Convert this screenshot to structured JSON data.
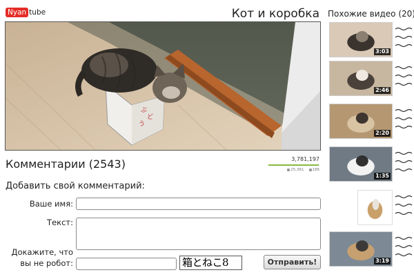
{
  "header": {
    "logo_red": "Nyan",
    "logo_rest": "tube",
    "title": "Кот и коробка"
  },
  "video": {
    "icon": "video-still"
  },
  "stats": {
    "views": "3,781,197",
    "likes": "25,361",
    "dislikes": "186",
    "rating_fraction": 0.99,
    "bar_color": "#86b93e"
  },
  "comments": {
    "title": "Комментарии (2543)"
  },
  "form": {
    "title": "Добавить свой комментарий:",
    "name_label": "Ваше имя:",
    "name_value": "",
    "text_label": "Текст:",
    "text_value": "",
    "robot_label_1": "Докажите, что",
    "robot_label_2": "вы не робот:",
    "robot_value": "",
    "captcha_text": "箱とねこ8",
    "submit_label": "Отправить!"
  },
  "related": {
    "title": "Похожие видео (20)",
    "items": [
      {
        "duration": "3:03"
      },
      {
        "duration": "2:46"
      },
      {
        "duration": "2:20"
      },
      {
        "duration": "1:35"
      },
      {
        "duration": ""
      },
      {
        "duration": "3:19"
      }
    ]
  },
  "colors": {
    "brand": "#e52d27",
    "accent": "#86b93e"
  }
}
